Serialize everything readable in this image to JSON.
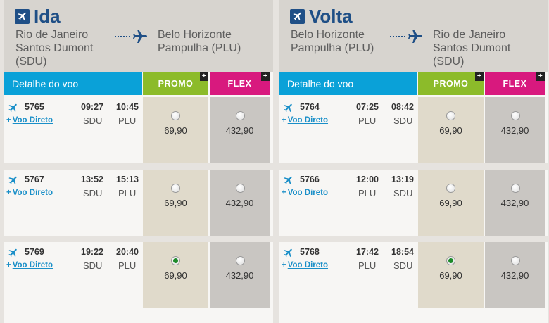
{
  "colors": {
    "brand_blue": "#1f4f86",
    "header_blue": "#0aa1d8",
    "promo_green": "#8cbb2a",
    "flex_pink": "#d8197e",
    "link_blue": "#1a8fc8"
  },
  "labels": {
    "detail": "Detalhe do voo",
    "promo": "PROMO",
    "flex": "FLEX",
    "direct": "Voo Direto",
    "plus": "+",
    "corner_plus": "+"
  },
  "outbound": {
    "title": "Ida",
    "from": "Rio de Janeiro\nSantos Dumont\n(SDU)",
    "to": "Belo Horizonte\nPampulha (PLU)",
    "flights": [
      {
        "number": "5765",
        "dep_time": "09:27",
        "arr_time": "10:45",
        "dep_airport": "SDU",
        "arr_airport": "PLU",
        "promo": "69,90",
        "flex": "432,90",
        "selected": ""
      },
      {
        "number": "5767",
        "dep_time": "13:52",
        "arr_time": "15:13",
        "dep_airport": "SDU",
        "arr_airport": "PLU",
        "promo": "69,90",
        "flex": "432,90",
        "selected": ""
      },
      {
        "number": "5769",
        "dep_time": "19:22",
        "arr_time": "20:40",
        "dep_airport": "SDU",
        "arr_airport": "PLU",
        "promo": "69,90",
        "flex": "432,90",
        "selected": "promo"
      }
    ]
  },
  "inbound": {
    "title": "Volta",
    "from": "Belo Horizonte\nPampulha (PLU)",
    "to": "Rio de Janeiro\nSantos Dumont\n(SDU)",
    "flights": [
      {
        "number": "5764",
        "dep_time": "07:25",
        "arr_time": "08:42",
        "dep_airport": "PLU",
        "arr_airport": "SDU",
        "promo": "69,90",
        "flex": "432,90",
        "selected": ""
      },
      {
        "number": "5766",
        "dep_time": "12:00",
        "arr_time": "13:19",
        "dep_airport": "PLU",
        "arr_airport": "SDU",
        "promo": "69,90",
        "flex": "432,90",
        "selected": ""
      },
      {
        "number": "5768",
        "dep_time": "17:42",
        "arr_time": "18:54",
        "dep_airport": "PLU",
        "arr_airport": "SDU",
        "promo": "69,90",
        "flex": "432,90",
        "selected": "promo"
      }
    ]
  }
}
